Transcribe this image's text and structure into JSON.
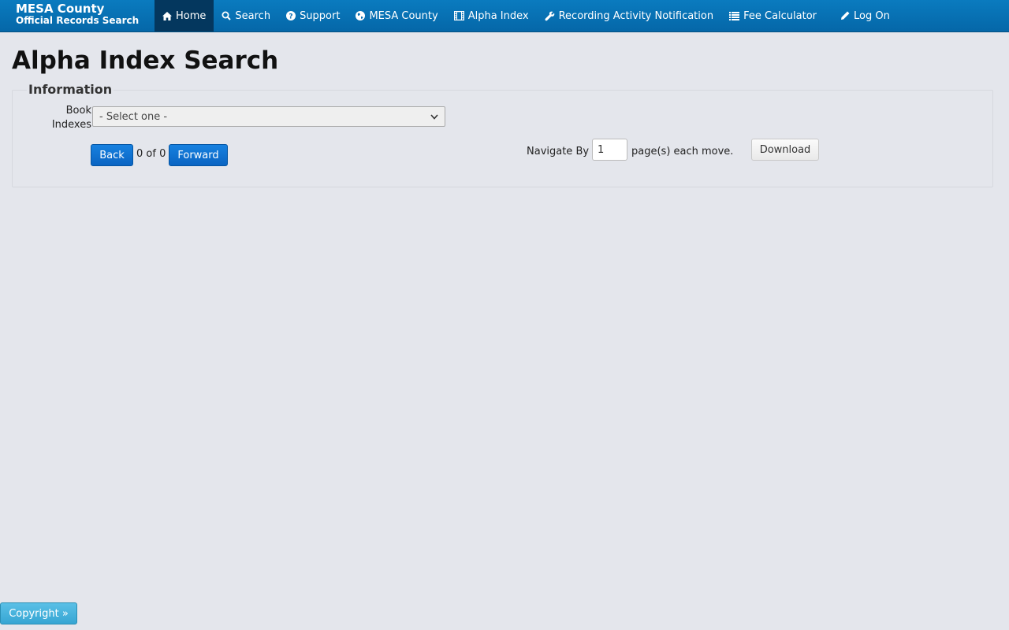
{
  "header": {
    "brand_line1": "MESA County",
    "brand_line2": "Official Records Search",
    "nav": [
      {
        "label": "Home",
        "icon": "home-icon",
        "active": true
      },
      {
        "label": "Search",
        "icon": "search-icon"
      },
      {
        "label": "Support",
        "icon": "question-circle-icon"
      },
      {
        "label": "MESA County",
        "icon": "globe-icon"
      },
      {
        "label": "Alpha Index",
        "icon": "film-icon"
      },
      {
        "label": "Recording Activity Notification",
        "icon": "wrench-icon"
      },
      {
        "label": "Fee Calculator",
        "icon": "list-icon"
      },
      {
        "label": "Log On",
        "icon": "pencil-icon"
      }
    ]
  },
  "page": {
    "title": "Alpha Index Search"
  },
  "information": {
    "legend": "Information",
    "book_label_line1": "Book",
    "book_label_line2": "Indexes",
    "book_select_value": "- Select one -",
    "back_label": "Back",
    "count_text": "0 of 0",
    "forward_label": "Forward",
    "navigate_by_label": "Navigate By",
    "navigate_by_value": "1",
    "each_move_label": "page(s) each move.",
    "download_label": "Download"
  },
  "footer": {
    "copyright_label": "Copyright »"
  },
  "colors": {
    "nav_bar": "#0a75b8",
    "nav_active": "#04375e",
    "primary_button": "#0a6fd0",
    "copyright_button": "#45b0dc",
    "page_background": "#e4e6ec"
  }
}
